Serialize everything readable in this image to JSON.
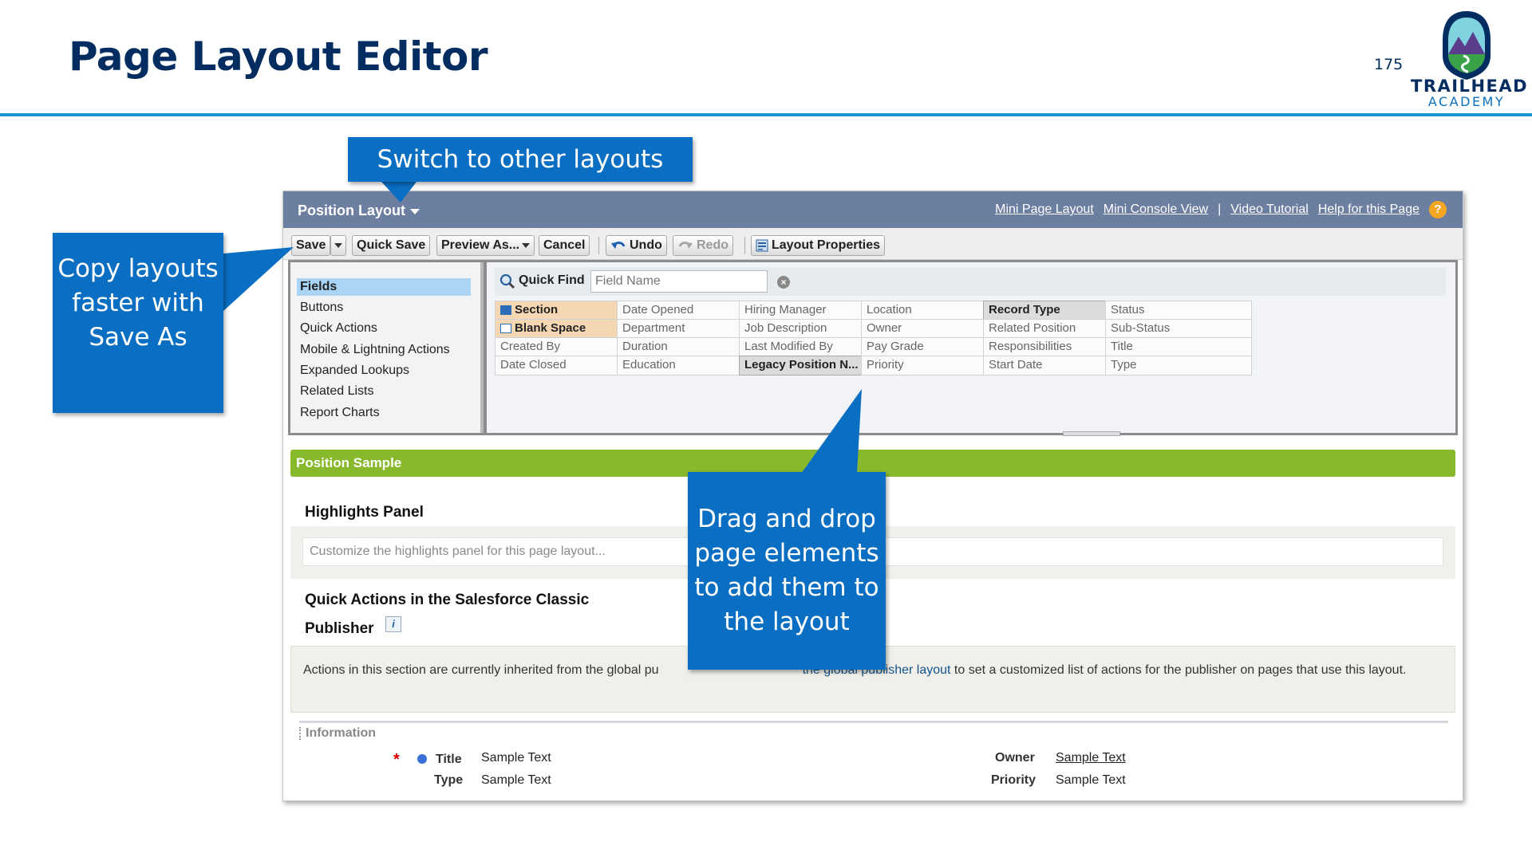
{
  "slide": {
    "title": "Page Layout Editor",
    "page_number": "175",
    "logo_line1": "TRAILHEAD",
    "logo_line2": "ACADEMY"
  },
  "callouts": {
    "switch_layouts": "Switch to other layouts",
    "copy_layouts": "Copy layouts faster with Save As",
    "drag_drop": "Drag and drop page elements to add them to the layout"
  },
  "editor": {
    "layout_name": "Position Layout",
    "header_links": [
      "Mini Page Layout",
      "Mini Console View",
      "Video Tutorial",
      "Help for this Page"
    ],
    "header_separator": "|",
    "help_icon_glyph": "?",
    "toolbar": {
      "save": "Save",
      "quick_save": "Quick Save",
      "preview_as": "Preview As...",
      "cancel": "Cancel",
      "undo": "Undo",
      "redo": "Redo",
      "layout_properties": "Layout Properties"
    },
    "categories": [
      "Fields",
      "Buttons",
      "Quick Actions",
      "Mobile & Lightning Actions",
      "Expanded Lookups",
      "Related Lists",
      "Report Charts"
    ],
    "selected_category": "Fields",
    "quick_find": {
      "label": "Quick Find",
      "placeholder": "Field Name",
      "clear_glyph": "×"
    },
    "fields": [
      [
        "Section",
        "Date Opened",
        "Hiring Manager",
        "Location",
        "Record Type",
        "Status"
      ],
      [
        "Blank Space",
        "Department",
        "Job Description",
        "Owner",
        "Related Position",
        "Sub-Status"
      ],
      [
        "Created By",
        "Duration",
        "Last Modified By",
        "Pay Grade",
        "Responsibilities",
        "Title"
      ],
      [
        "Date Closed",
        "Education",
        "Legacy Position N...",
        "Priority",
        "Start Date",
        "Type"
      ]
    ]
  },
  "canvas": {
    "section_title": "Position Sample",
    "highlights_title": "Highlights Panel",
    "highlights_placeholder": "Customize the highlights panel for this page layout...",
    "quick_actions_title_line1": "Quick Actions in the Salesforce Classic",
    "quick_actions_title_line2": "Publisher",
    "info_glyph": "i",
    "quick_actions_text_before": "Actions in this section are currently inherited from the global pu",
    "quick_actions_link": "the global publisher layout",
    "quick_actions_text_after": " to set a customized list of actions for the publisher on pages that use this layout.",
    "information_header": "Information",
    "required_glyph": "*",
    "rows": [
      {
        "label_left": "Title",
        "value_left": "Sample Text",
        "label_right": "Owner",
        "value_right": "Sample Text"
      },
      {
        "label_left": "Type",
        "value_left": "Sample Text",
        "label_right": "Priority",
        "value_right": "Sample Text"
      }
    ]
  },
  "colors": {
    "title_navy": "#032d60",
    "rule_blue": "#1b96d6",
    "callout_blue": "#0a6fc2",
    "header_slate": "#6d7fa0",
    "section_green": "#88b82c",
    "selected_category": "#a9d4f5"
  }
}
